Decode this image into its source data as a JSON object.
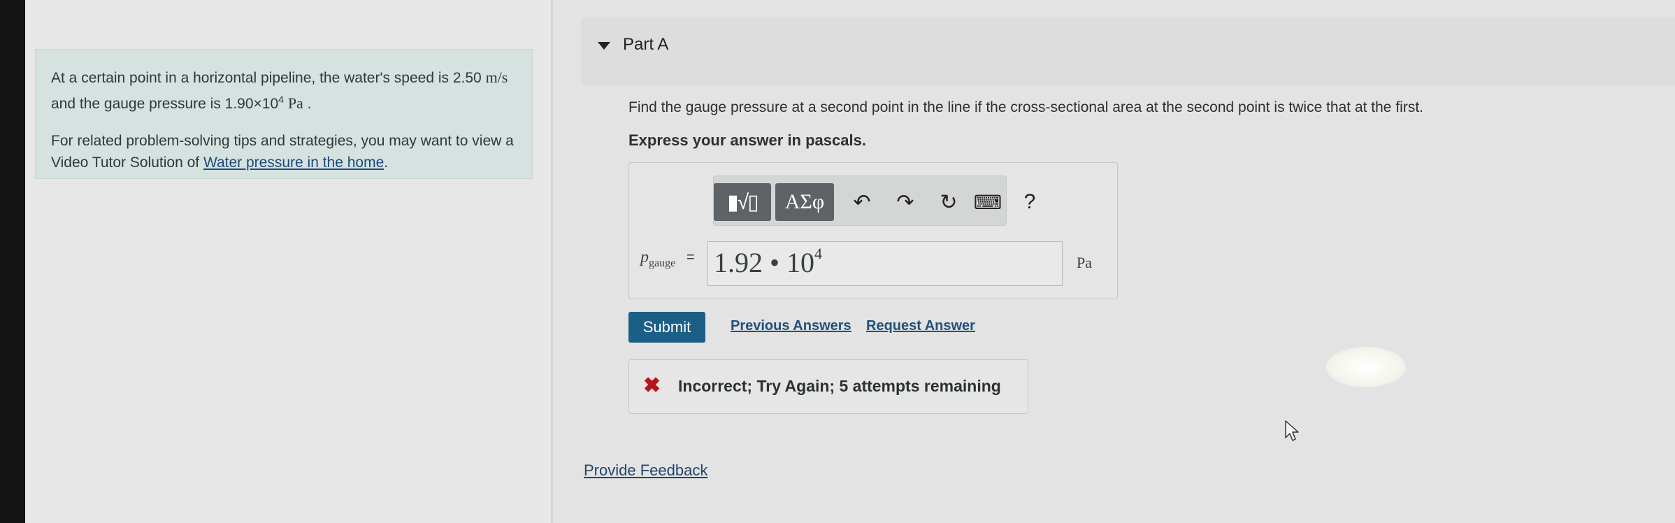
{
  "problem": {
    "line1_text": "At a certain point in a horizontal pipeline, the water's speed is 2.50",
    "speed_unit": "m/s",
    "line2_text": " and the gauge pressure is 1.90×10",
    "pressure_exp": "4",
    "pressure_unit": "Pa",
    "tip_text": "For related problem-solving tips and strategies, you may want to view a Video Tutor Solution of ",
    "tip_link": "Water pressure in the home",
    "tip_end": "."
  },
  "part": {
    "title": "Part A",
    "question": "Find the gauge pressure at a second point in the line if the cross-sectional area at the second point is twice that at the first.",
    "instruction": "Express your answer in pascals."
  },
  "toolbar": {
    "templates_label": "▮√▯",
    "greek_label": "ΑΣφ",
    "undo_glyph": "↶",
    "redo_glyph": "↷",
    "reset_glyph": "↻",
    "keyboard_glyph": "⌨",
    "help_label": "?"
  },
  "answer": {
    "variable": "p",
    "variable_sub": "gauge",
    "equals": "=",
    "mantissa": "1.92 • 10",
    "exponent": "4",
    "unit": "Pa"
  },
  "actions": {
    "submit": "Submit",
    "previous_answers": "Previous Answers",
    "request_answer": "Request Answer"
  },
  "feedback": {
    "icon": "✖",
    "message": "Incorrect; Try Again; 5 attempts remaining"
  },
  "footer": {
    "provide_feedback": "Provide Feedback"
  }
}
